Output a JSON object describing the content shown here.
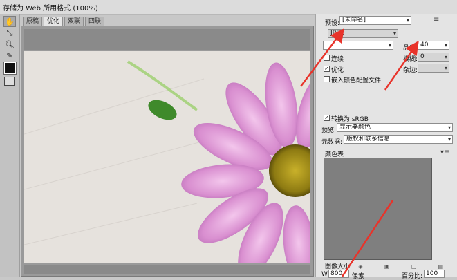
{
  "window": {
    "title": "存储为 Web 所用格式 (100%)"
  },
  "tabs": [
    {
      "label": "原稿",
      "active": false
    },
    {
      "label": "优化",
      "active": true
    },
    {
      "label": "双联",
      "active": false
    },
    {
      "label": "四联",
      "active": false
    }
  ],
  "tools": [
    "hand-tool",
    "slice-select-tool",
    "zoom-tool",
    "eyedropper-tool"
  ],
  "settings": {
    "preset_label": "预设:",
    "preset_value": "[未命名]",
    "format_value": "JPEG",
    "quality_compression_value": "",
    "quality_label": "品质:",
    "quality_value": "40",
    "progressive_label": "连续",
    "optimized_label": "优化",
    "embed_profile_label": "嵌入颜色配置文件",
    "blur_label": "模糊:",
    "blur_value": "0",
    "matte_label": "杂边:",
    "matte_value": "",
    "convert_srgb_label": "转换为 sRGB",
    "preview_label": "预览:",
    "preview_value": "显示器颜色",
    "metadata_label": "元数据:",
    "metadata_value": "版权和联系信息"
  },
  "checkbox_states": {
    "progressive": false,
    "optimized": true,
    "embed_profile": false,
    "convert_srgb": true
  },
  "color_table": {
    "title": "颜色表"
  },
  "image_size": {
    "title": "图像大小",
    "w_label": "W:",
    "w_value": "800",
    "unit_label": "像素",
    "percent_label": "百分比:",
    "percent_value": "100"
  },
  "colors": {
    "annotation_arrow": "#e8332a",
    "accent": "#2f6fd0"
  }
}
